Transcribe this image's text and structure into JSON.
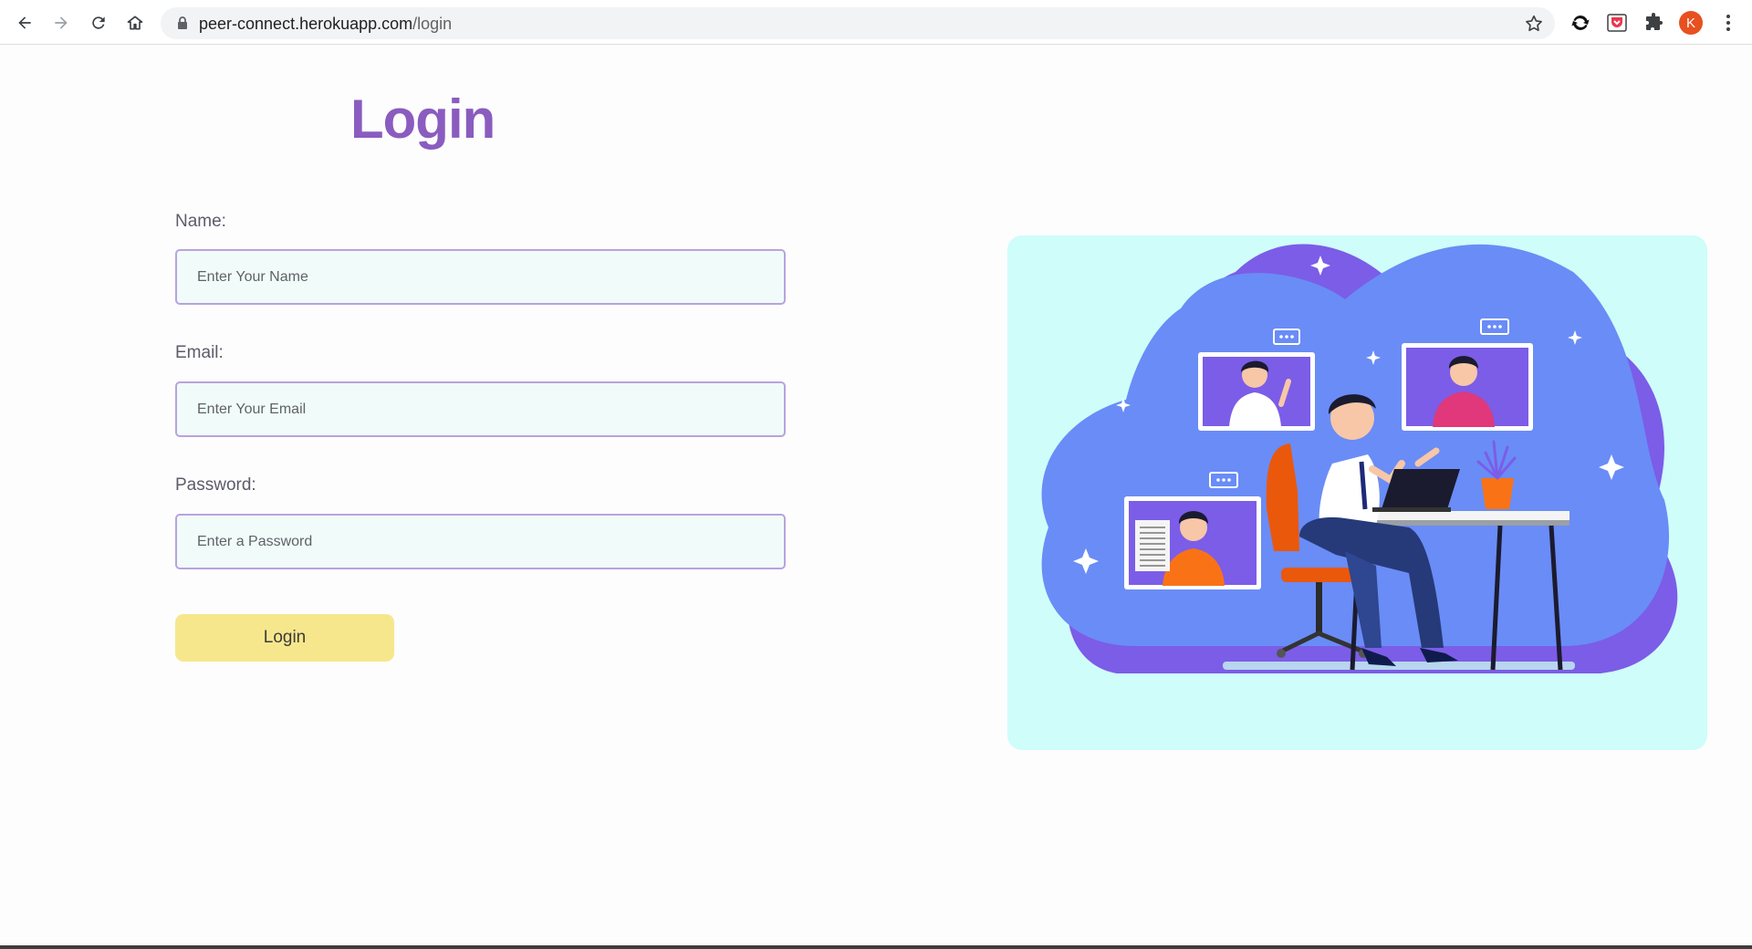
{
  "browser": {
    "url_host": "peer-connect.herokuapp.com",
    "url_path": "/login",
    "avatar_letter": "K",
    "icons": [
      "back-icon",
      "forward-icon",
      "reload-icon",
      "home-icon",
      "lock-icon",
      "star-icon",
      "sync-extension-icon",
      "pocket-extension-icon",
      "puzzle-icon",
      "kebab-menu-icon"
    ]
  },
  "page": {
    "title": "Login",
    "form": {
      "name_label": "Name:",
      "name_placeholder": "Enter Your Name",
      "email_label": "Email:",
      "email_placeholder": "Enter Your Email",
      "password_label": "Password:",
      "password_placeholder": "Enter a Password",
      "submit_label": "Login"
    }
  },
  "colors": {
    "title": "#8a5cbf",
    "input_border": "#b9a3dc",
    "input_bg": "#f1fbfa",
    "button_bg": "#f7e78c",
    "illustration_bg": "#cffdf9"
  }
}
